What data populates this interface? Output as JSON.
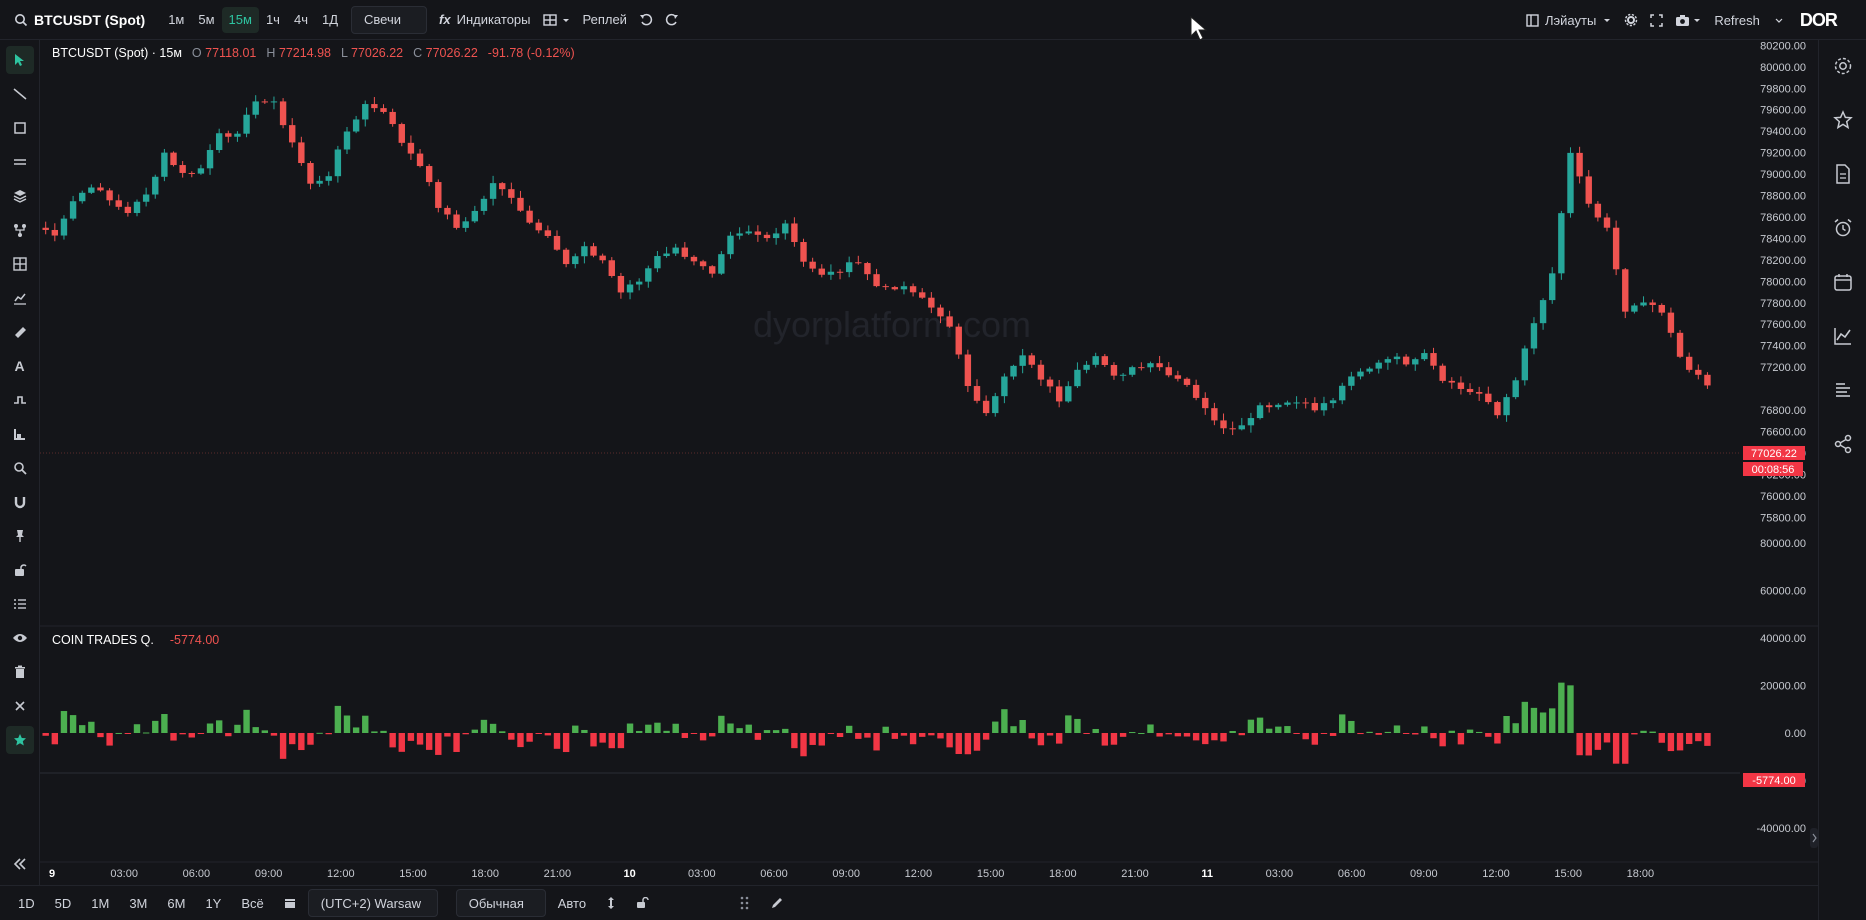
{
  "toolbar": {
    "symbol": "BTCUSDT (Spot)",
    "timeframes": [
      "1м",
      "5м",
      "15м",
      "1ч",
      "4ч",
      "1Д"
    ],
    "active_timeframe": "15м",
    "chart_type": "Свечи",
    "indicators_label": "Индикаторы",
    "replay_label": "Реплей",
    "layouts_label": "Лэйауты",
    "refresh_label": "Refresh",
    "logo_text": "DOR"
  },
  "legend": {
    "title": "BTCUSDT (Spot) · 15м",
    "o_label": "O",
    "o_value": "77118.01",
    "h_label": "H",
    "h_value": "77214.98",
    "l_label": "L",
    "l_value": "77026.22",
    "c_label": "C",
    "c_value": "77026.22",
    "change": "-91.78 (-0.12%)"
  },
  "volume_legend": {
    "title": "COIN TRADES Q.",
    "value": "-5774.00"
  },
  "watermark": "dyorplatform.com",
  "price_axis": {
    "labels": [
      "80200.00",
      "80000.00",
      "79800.00",
      "79600.00",
      "79400.00",
      "79200.00",
      "79000.00",
      "78800.00",
      "78600.00",
      "78400.00",
      "78200.00",
      "78000.00",
      "77800.00",
      "77600.00",
      "77400.00",
      "77200.00",
      "76800.00",
      "76600.00",
      "76400.00",
      "76200.00",
      "76000.00",
      "75800.00"
    ],
    "current_price": "77026.22",
    "countdown": "00:08:56"
  },
  "volume_axis": {
    "labels": [
      "80000.00",
      "60000.00",
      "40000.00",
      "20000.00",
      "0.00",
      "-20000.00",
      "-40000.00"
    ],
    "current_value": "-5774.00"
  },
  "time_axis": [
    "9",
    "03:00",
    "06:00",
    "09:00",
    "12:00",
    "15:00",
    "18:00",
    "21:00",
    "10",
    "03:00",
    "06:00",
    "09:00",
    "12:00",
    "15:00",
    "18:00",
    "21:00",
    "11",
    "03:00",
    "06:00",
    "09:00",
    "12:00",
    "15:00",
    "18:00"
  ],
  "bottombar": {
    "ranges": [
      "1D",
      "5D",
      "1M",
      "3M",
      "6M",
      "1Y",
      "Всё"
    ],
    "timezone": "(UTC+2) Warsaw",
    "scale_mode": "Обычная",
    "auto_label": "Авто"
  },
  "colors": {
    "up": "#26a69a",
    "down": "#ef5350",
    "vol_up": "#4caf50",
    "vol_down": "#f23645",
    "accent": "#2ec4a0",
    "bg": "#141519"
  },
  "chart_data": {
    "type": "candlestick",
    "ylim": [
      75700,
      80250
    ],
    "anchors": [
      [
        0,
        78500
      ],
      [
        10,
        78450
      ],
      [
        20,
        78750
      ],
      [
        30,
        78900
      ],
      [
        40,
        78750
      ],
      [
        50,
        78650
      ],
      [
        60,
        78800
      ],
      [
        70,
        79200
      ],
      [
        80,
        79000
      ],
      [
        90,
        79050
      ],
      [
        100,
        79400
      ],
      [
        110,
        79350
      ],
      [
        120,
        79700
      ],
      [
        130,
        79650
      ],
      [
        140,
        79300
      ],
      [
        150,
        78900
      ],
      [
        160,
        79000
      ],
      [
        170,
        79400
      ],
      [
        180,
        79650
      ],
      [
        190,
        79600
      ],
      [
        200,
        79300
      ],
      [
        210,
        79100
      ],
      [
        220,
        78700
      ],
      [
        230,
        78500
      ],
      [
        240,
        78650
      ],
      [
        250,
        78900
      ],
      [
        260,
        78800
      ],
      [
        270,
        78550
      ],
      [
        280,
        78450
      ],
      [
        290,
        78150
      ],
      [
        300,
        78300
      ],
      [
        310,
        78200
      ],
      [
        320,
        77900
      ],
      [
        330,
        78000
      ],
      [
        340,
        78250
      ],
      [
        350,
        78300
      ],
      [
        360,
        78200
      ],
      [
        370,
        78050
      ],
      [
        380,
        78400
      ],
      [
        390,
        78450
      ],
      [
        400,
        78400
      ],
      [
        410,
        78550
      ],
      [
        420,
        78200
      ],
      [
        430,
        78050
      ],
      [
        440,
        78100
      ],
      [
        450,
        78200
      ],
      [
        460,
        77950
      ],
      [
        470,
        77950
      ],
      [
        480,
        77900
      ],
      [
        490,
        77750
      ],
      [
        500,
        77600
      ],
      [
        510,
        77000
      ],
      [
        520,
        76800
      ],
      [
        530,
        77100
      ],
      [
        540,
        77300
      ],
      [
        550,
        77100
      ],
      [
        560,
        76900
      ],
      [
        570,
        77200
      ],
      [
        580,
        77300
      ],
      [
        590,
        77100
      ],
      [
        600,
        77200
      ],
      [
        610,
        77250
      ],
      [
        620,
        77150
      ],
      [
        630,
        77050
      ],
      [
        640,
        76800
      ],
      [
        650,
        76650
      ],
      [
        660,
        76650
      ],
      [
        670,
        76850
      ],
      [
        680,
        76850
      ],
      [
        690,
        76900
      ],
      [
        700,
        76800
      ],
      [
        710,
        76900
      ],
      [
        720,
        77100
      ],
      [
        730,
        77200
      ],
      [
        740,
        77300
      ],
      [
        750,
        77250
      ],
      [
        760,
        77350
      ],
      [
        770,
        77100
      ],
      [
        780,
        77000
      ],
      [
        790,
        76950
      ],
      [
        800,
        76750
      ],
      [
        810,
        77100
      ],
      [
        820,
        77600
      ],
      [
        830,
        78050
      ],
      [
        840,
        79200
      ],
      [
        850,
        78700
      ],
      [
        860,
        78500
      ],
      [
        870,
        77700
      ],
      [
        880,
        77800
      ],
      [
        890,
        77700
      ],
      [
        900,
        77300
      ],
      [
        910,
        77100
      ],
      [
        915,
        77026
      ]
    ]
  }
}
